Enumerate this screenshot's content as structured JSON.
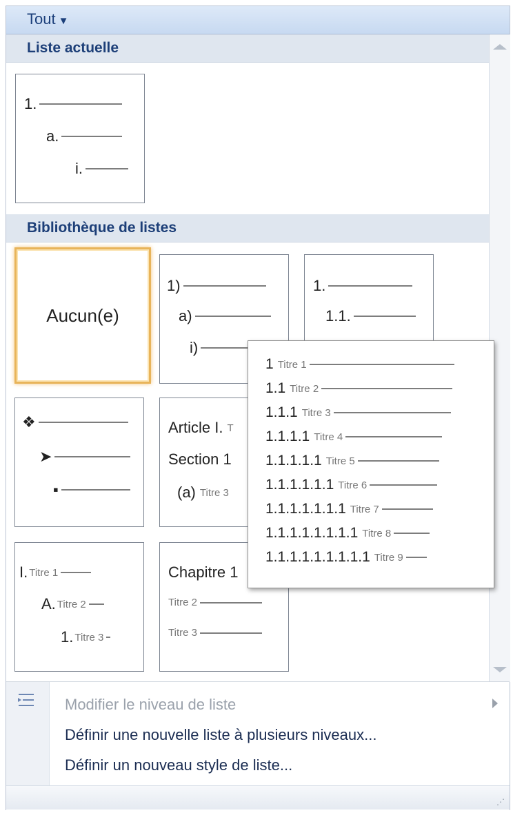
{
  "filter": {
    "label": "Tout"
  },
  "sections": {
    "current": "Liste actuelle",
    "library": "Bibliothèque de listes"
  },
  "current_list": {
    "lines": [
      {
        "prefix": "1."
      },
      {
        "prefix": "a."
      },
      {
        "prefix": "i."
      }
    ]
  },
  "library": {
    "none_label": "Aucun(e)",
    "numbered_paren": [
      "1)",
      "a)",
      "i)"
    ],
    "legal_style": [
      "1.",
      "1.1."
    ],
    "bullets": [
      "❖",
      "➤",
      "▪"
    ],
    "article": [
      {
        "num": "Article I.",
        "title": "T"
      },
      {
        "num": "Section 1",
        "title": ""
      },
      {
        "num": "(a)",
        "title": "Titre 3"
      }
    ],
    "roman_titles": [
      {
        "num": "I.",
        "title": "Titre 1"
      },
      {
        "num": "A.",
        "title": "Titre 2"
      },
      {
        "num": "1.",
        "title": "Titre 3"
      }
    ],
    "chapter": [
      {
        "num": "Chapitre 1",
        "title": ""
      },
      {
        "num": "",
        "title": "Titre 2"
      },
      {
        "num": "",
        "title": "Titre 3"
      }
    ]
  },
  "tooltip_preview": [
    {
      "num": "1",
      "title": "Titre 1"
    },
    {
      "num": "1.1",
      "title": "Titre 2"
    },
    {
      "num": "1.1.1",
      "title": "Titre 3"
    },
    {
      "num": "1.1.1.1",
      "title": "Titre 4"
    },
    {
      "num": "1.1.1.1.1",
      "title": "Titre 5"
    },
    {
      "num": "1.1.1.1.1.1",
      "title": "Titre 6"
    },
    {
      "num": "1.1.1.1.1.1.1",
      "title": "Titre 7"
    },
    {
      "num": "1.1.1.1.1.1.1.1",
      "title": "Titre 8"
    },
    {
      "num": "1.1.1.1.1.1.1.1.1",
      "title": "Titre 9"
    }
  ],
  "menu": {
    "change_level": "Modifier le niveau de liste",
    "define_multilevel": "Définir une nouvelle liste à plusieurs niveaux...",
    "define_style": "Définir un nouveau style de liste..."
  },
  "icons": {
    "dropdown": "caret-down-icon",
    "change_level": "list-level-icon",
    "submenu": "chevron-right-icon",
    "resize": "resize-grip-icon"
  },
  "colors": {
    "header_text": "#1d3f78",
    "selected_border": "#e8b45a",
    "section_bg": "#dfe6ef"
  }
}
